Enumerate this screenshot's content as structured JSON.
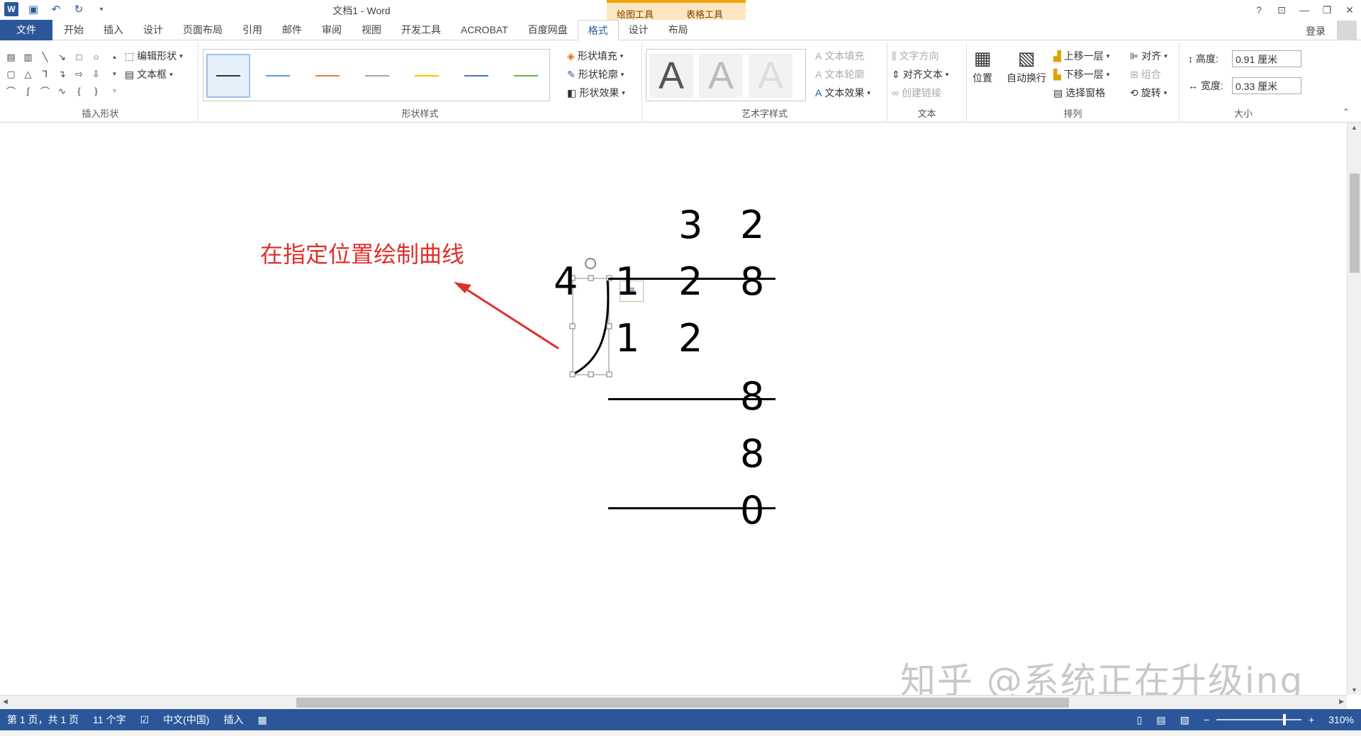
{
  "titlebar": {
    "title": "文档1 - Word",
    "context_tab_drawing": "绘图工具",
    "context_tab_table": "表格工具",
    "help": "?",
    "qat": {
      "app_icon": "W"
    }
  },
  "tabs": [
    "文件",
    "开始",
    "插入",
    "设计",
    "页面布局",
    "引用",
    "邮件",
    "审阅",
    "视图",
    "开发工具",
    "ACROBAT",
    "百度网盘",
    "格式",
    "设计",
    "布局"
  ],
  "active_tab": "格式",
  "login": "登录",
  "ribbon": {
    "insert_shapes": {
      "label": "插入形状",
      "edit_shape": "编辑形状",
      "text_box": "文本框"
    },
    "shape_styles": {
      "label": "形状样式",
      "fill": "形状填充",
      "outline": "形状轮廓",
      "effects": "形状效果",
      "swatch_colors": [
        "#333333",
        "#5b9bd5",
        "#ed7d31",
        "#a5a5a5",
        "#ffc000",
        "#4472c4",
        "#70ad47"
      ]
    },
    "wordart": {
      "label": "艺术字样式",
      "text_fill": "文本填充",
      "text_outline": "文本轮廓",
      "text_effects": "文本效果",
      "letter": "A"
    },
    "text": {
      "label": "文本",
      "direction": "文字方向",
      "align": "对齐文本",
      "link": "创建链接"
    },
    "arrange": {
      "label": "排列",
      "position": "位置",
      "wrap": "自动换行",
      "forward": "上移一层",
      "backward": "下移一层",
      "pane": "选择窗格",
      "align": "对齐",
      "group": "组合",
      "rotate": "旋转"
    },
    "size": {
      "label": "大小",
      "height_label": "高度:",
      "height_value": "0.91 厘米",
      "width_label": "宽度:",
      "width_value": "0.33 厘米"
    }
  },
  "document": {
    "annotation": "在指定位置绘制曲线",
    "quotient": [
      "3",
      "2"
    ],
    "divisor": "4",
    "dividend": [
      "1",
      "2",
      "8"
    ],
    "step1": [
      "1",
      "2"
    ],
    "step2a": "8",
    "step2b": "8",
    "remainder": "0",
    "watermark": "知乎 @系统正在升级ing"
  },
  "statusbar": {
    "page": "第 1 页，共 1 页",
    "words": "11 个字",
    "lang": "中文(中国)",
    "mode": "插入",
    "zoom": "310%"
  }
}
